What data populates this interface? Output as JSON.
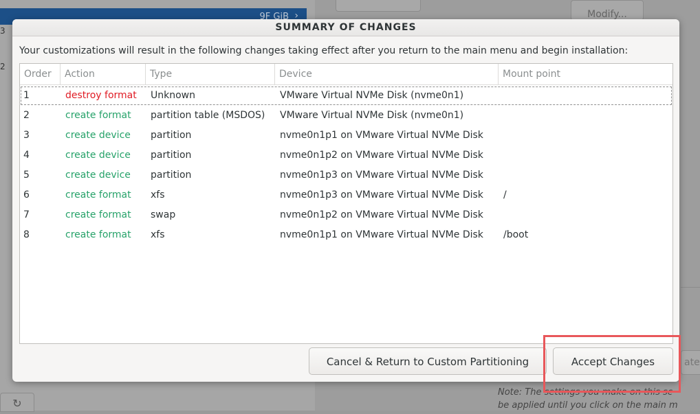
{
  "background": {
    "selected_row_text": "9F GiB",
    "side_numbers": [
      "3",
      "2"
    ],
    "modify_label": "Modify...",
    "refresh_glyph": "↻",
    "note_line1": "Note:  The settings you make on this sc",
    "note_line2": "be applied until you click on the main m",
    "right_btn_label": "ate"
  },
  "dialog": {
    "title": "SUMMARY OF CHANGES",
    "message": "Your customizations will result in the following changes taking effect after you return to the main menu and begin installation:",
    "columns": [
      "Order",
      "Action",
      "Type",
      "Device",
      "Mount point"
    ],
    "rows": [
      {
        "order": "1",
        "action": "destroy format",
        "type": "Unknown",
        "device": "VMware Virtual NVMe Disk (nvme0n1)",
        "mount": ""
      },
      {
        "order": "2",
        "action": "create format",
        "type": "partition table (MSDOS)",
        "device": "VMware Virtual NVMe Disk (nvme0n1)",
        "mount": ""
      },
      {
        "order": "3",
        "action": "create device",
        "type": "partition",
        "device": "nvme0n1p1 on VMware Virtual NVMe Disk",
        "mount": ""
      },
      {
        "order": "4",
        "action": "create device",
        "type": "partition",
        "device": "nvme0n1p2 on VMware Virtual NVMe Disk",
        "mount": ""
      },
      {
        "order": "5",
        "action": "create device",
        "type": "partition",
        "device": "nvme0n1p3 on VMware Virtual NVMe Disk",
        "mount": ""
      },
      {
        "order": "6",
        "action": "create format",
        "type": "xfs",
        "device": "nvme0n1p3 on VMware Virtual NVMe Disk",
        "mount": "/"
      },
      {
        "order": "7",
        "action": "create format",
        "type": "swap",
        "device": "nvme0n1p2 on VMware Virtual NVMe Disk",
        "mount": ""
      },
      {
        "order": "8",
        "action": "create format",
        "type": "xfs",
        "device": "nvme0n1p1 on VMware Virtual NVMe Disk",
        "mount": "/boot"
      }
    ],
    "cancel_label": "Cancel & Return to Custom Partitioning",
    "accept_label": "Accept Changes"
  },
  "colors": {
    "destroy": "#e01b24",
    "create": "#26a269",
    "highlight": "#e8575a"
  }
}
